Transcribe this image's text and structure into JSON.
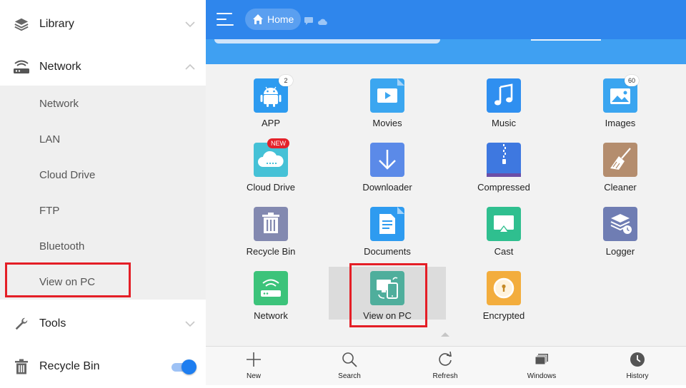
{
  "sidebar": {
    "items": [
      {
        "label": "Library"
      },
      {
        "label": "Network"
      },
      {
        "label": "Tools"
      },
      {
        "label": "Recycle Bin"
      }
    ],
    "network_sub": [
      {
        "label": "Network"
      },
      {
        "label": "LAN"
      },
      {
        "label": "Cloud Drive"
      },
      {
        "label": "FTP"
      },
      {
        "label": "Bluetooth"
      },
      {
        "label": "View on PC"
      }
    ],
    "recycle_toggle_on": true
  },
  "header": {
    "breadcrumb_home": "Home"
  },
  "grid": {
    "tiles": [
      {
        "label": "APP",
        "badge": "2",
        "color": "#2d9bf0"
      },
      {
        "label": "Movies",
        "color": "#3ba6f0"
      },
      {
        "label": "Music",
        "color": "#2f8ff0"
      },
      {
        "label": "Images",
        "badge": "60",
        "color": "#3aa5f0"
      },
      {
        "label": "Cloud Drive",
        "badge": "NEW",
        "color": "#45c1d6"
      },
      {
        "label": "Downloader",
        "color": "#5b8ae8"
      },
      {
        "label": "Compressed",
        "color": "#3e78e0"
      },
      {
        "label": "Cleaner",
        "color": "#b48d6e"
      },
      {
        "label": "Recycle Bin",
        "color": "#8389b0"
      },
      {
        "label": "Documents",
        "color": "#2e9bf0"
      },
      {
        "label": "Cast",
        "color": "#2fbf8f"
      },
      {
        "label": "Logger",
        "color": "#6f7db3"
      },
      {
        "label": "Network",
        "color": "#3cc37a"
      },
      {
        "label": "View on PC",
        "color": "#4fae9c"
      },
      {
        "label": "Encrypted",
        "color": "#f3ad3d"
      }
    ]
  },
  "bottombar": {
    "items": [
      {
        "label": "New"
      },
      {
        "label": "Search"
      },
      {
        "label": "Refresh"
      },
      {
        "label": "Windows"
      },
      {
        "label": "History"
      }
    ]
  },
  "colors": {
    "primary": "#2f86ec",
    "highlight_red": "#e41e26"
  }
}
